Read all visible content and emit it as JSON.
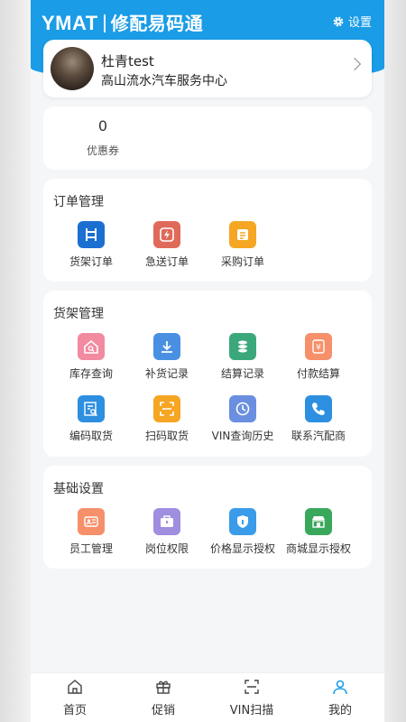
{
  "header": {
    "brand": "YMAT",
    "title": "修配易码通",
    "settings_label": "设置"
  },
  "profile": {
    "name": "杜青test",
    "org": "高山流水汽车服务中心"
  },
  "coupon": {
    "count": "0",
    "label": "优惠券"
  },
  "orders": {
    "title": "订单管理",
    "items": [
      {
        "label": "货架订单",
        "icon": "shelf-order-icon",
        "color": "#1a6fd1"
      },
      {
        "label": "急送订单",
        "icon": "urgent-order-icon",
        "color": "#e06a5a"
      },
      {
        "label": "采购订单",
        "icon": "purchase-order-icon",
        "color": "#f5a623"
      }
    ]
  },
  "shelf": {
    "title": "货架管理",
    "items": [
      {
        "label": "库存查询",
        "icon": "inventory-icon",
        "color": "#f28aa0"
      },
      {
        "label": "补货记录",
        "icon": "restock-icon",
        "color": "#4a90e2"
      },
      {
        "label": "结算记录",
        "icon": "settlement-icon",
        "color": "#3aa87a"
      },
      {
        "label": "付款结算",
        "icon": "payment-icon",
        "color": "#f5906a"
      },
      {
        "label": "编码取货",
        "icon": "code-pickup-icon",
        "color": "#2d8fe0"
      },
      {
        "label": "扫码取货",
        "icon": "scan-pickup-icon",
        "color": "#f5a623"
      },
      {
        "label": "VIN查询历史",
        "icon": "vin-history-icon",
        "color": "#6a8fe0"
      },
      {
        "label": "联系汽配商",
        "icon": "contact-icon",
        "color": "#2d8fe0"
      }
    ]
  },
  "base": {
    "title": "基础设置",
    "items": [
      {
        "label": "员工管理",
        "icon": "staff-icon",
        "color": "#f5906a"
      },
      {
        "label": "岗位权限",
        "icon": "role-icon",
        "color": "#a08ee0"
      },
      {
        "label": "价格显示授权",
        "icon": "price-auth-icon",
        "color": "#3a9be8"
      },
      {
        "label": "商城显示授权",
        "icon": "mall-auth-icon",
        "color": "#3aa85a"
      }
    ]
  },
  "tabs": [
    {
      "label": "首页",
      "icon": "home-icon"
    },
    {
      "label": "促销",
      "icon": "gift-icon"
    },
    {
      "label": "VIN扫描",
      "icon": "scan-icon"
    },
    {
      "label": "我的",
      "icon": "user-icon",
      "active": true
    }
  ]
}
